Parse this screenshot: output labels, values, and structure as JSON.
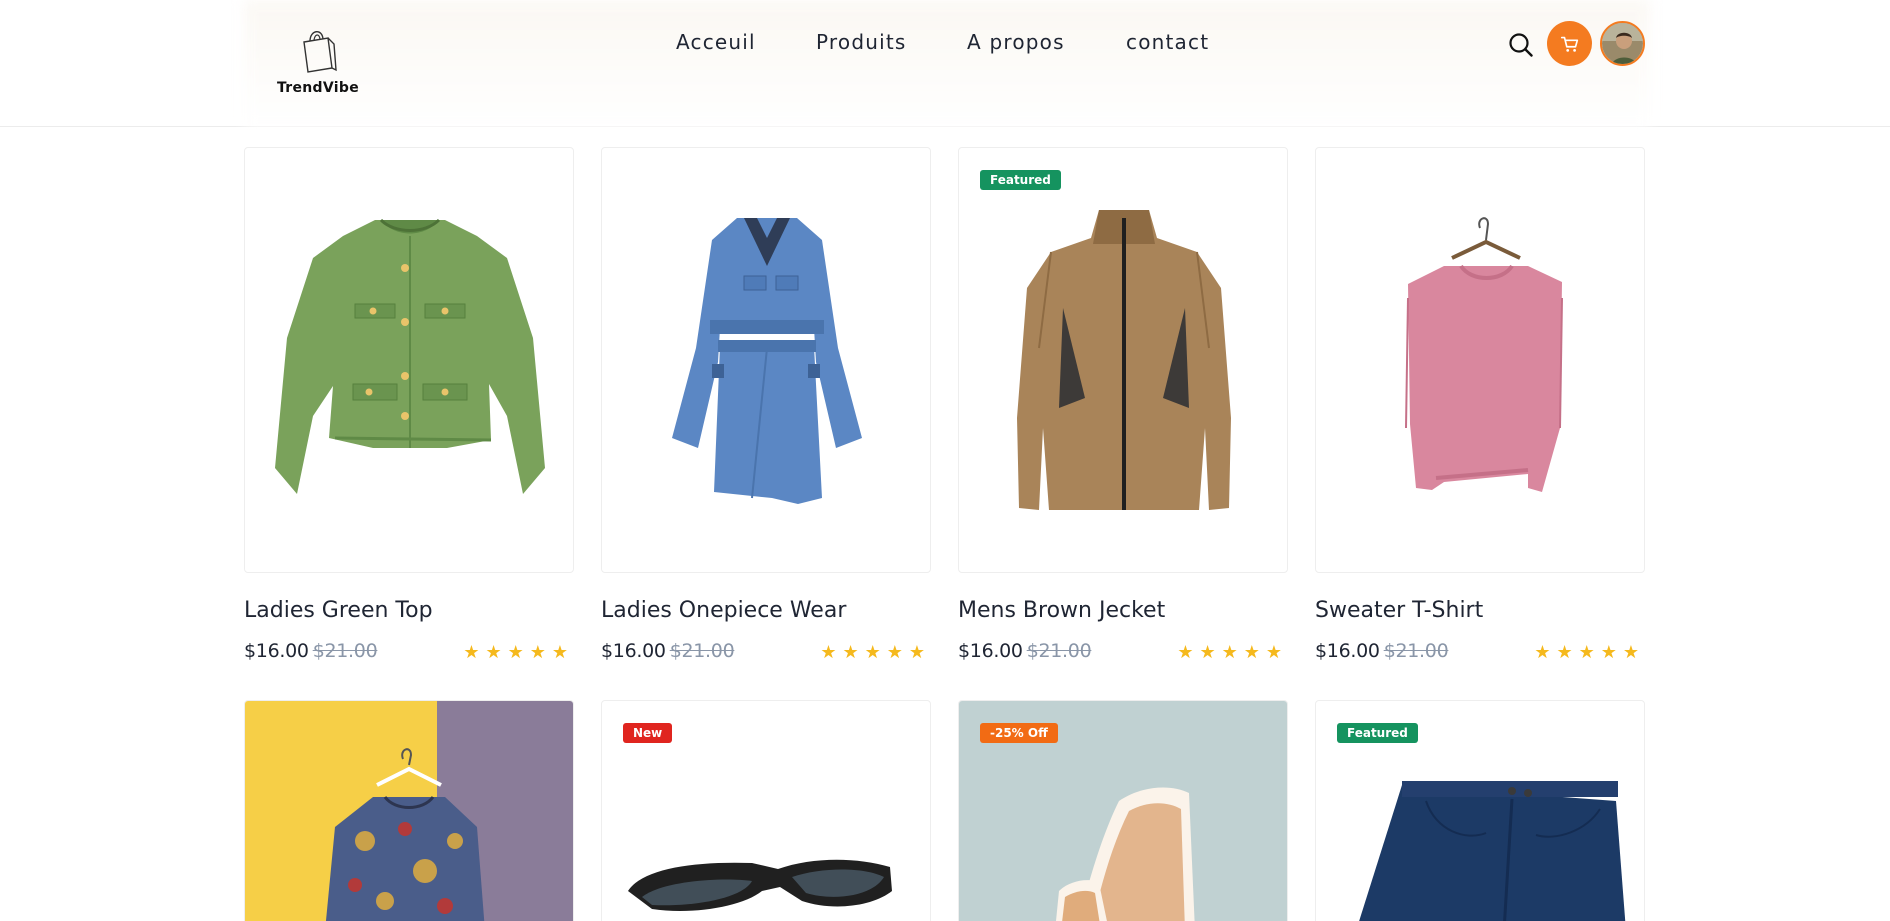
{
  "brand": {
    "name": "TrendVibe"
  },
  "nav": {
    "items": [
      "Acceuil",
      "Produits",
      "A propos",
      "contact"
    ]
  },
  "header": {
    "search_icon": "search-icon",
    "cart_icon": "cart-icon",
    "accent": "#f47b20"
  },
  "products": [
    {
      "title": "Ladies Green Top",
      "price": "$16.00",
      "old_price": "$21.00",
      "rating": 5,
      "badge": ""
    },
    {
      "title": "Ladies Onepiece Wear",
      "price": "$16.00",
      "old_price": "$21.00",
      "rating": 5,
      "badge": ""
    },
    {
      "title": "Mens Brown Jecket",
      "price": "$16.00",
      "old_price": "$21.00",
      "rating": 5,
      "badge": "Featured",
      "badge_color": "#15935f"
    },
    {
      "title": "Sweater T-Shirt",
      "price": "$16.00",
      "old_price": "$21.00",
      "rating": 5,
      "badge": ""
    },
    {
      "badge": ""
    },
    {
      "badge": "New",
      "badge_color": "#e0251f"
    },
    {
      "badge": "-25% Off",
      "badge_color": "#f26b14"
    },
    {
      "badge": "Featured",
      "badge_color": "#15935f"
    }
  ],
  "star_glyphs": "★★★★★",
  "colors": {
    "star": "#f5b91d",
    "old_price": "#8a96a8"
  }
}
